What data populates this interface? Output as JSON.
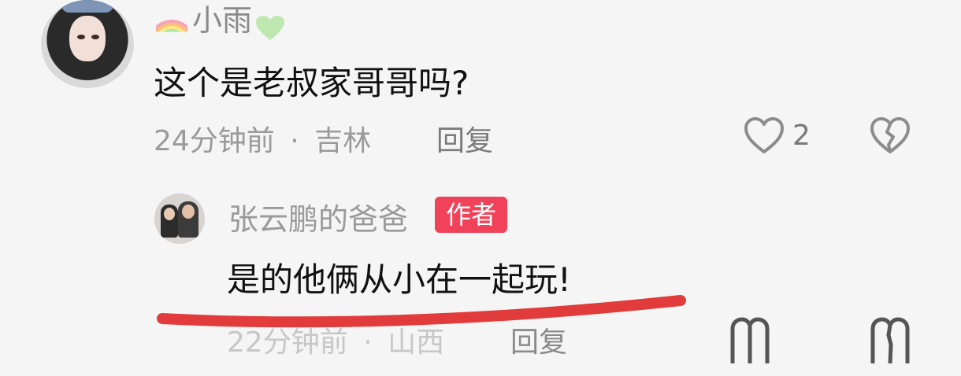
{
  "comments": [
    {
      "username": "小雨",
      "text": "这个是老叔家哥哥吗?",
      "time": "24分钟前",
      "location": "吉林",
      "reply_label": "回复",
      "likes": "2"
    },
    {
      "username": "张云鹏的爸爸",
      "badge": "作者",
      "text": "是的他俩从小在一起玩!",
      "time": "22分钟前",
      "location": "山西",
      "reply_label": "回复"
    }
  ],
  "separator": "·",
  "icons": {
    "name_prefix": "rainbow-icon",
    "name_suffix": "green-heart-icon",
    "like": "heart-outline-icon",
    "dislike": "broken-heart-icon"
  },
  "colors": {
    "background": "#f5f5f5",
    "badge": "#f0435a",
    "underline": "#e23b3b",
    "muted_text": "#9a9a9a",
    "main_text": "#111111"
  }
}
